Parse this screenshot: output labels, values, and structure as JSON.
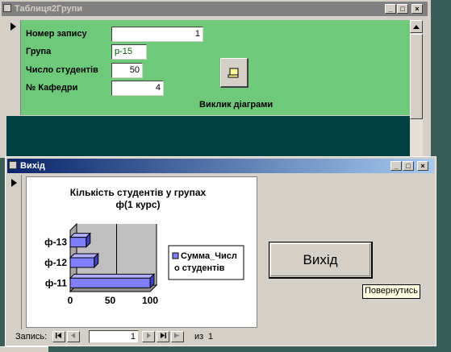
{
  "top_window": {
    "title": "Таблиця2Групи",
    "fields": [
      {
        "label": "Номер запису",
        "value": "1"
      },
      {
        "label": "Група",
        "value": "р-15"
      },
      {
        "label": "Число студентів",
        "value": "50"
      },
      {
        "label": "№ Кафедри",
        "value": "4"
      }
    ],
    "chart_button_label": "Виклик діаграми"
  },
  "bottom_window": {
    "title": "Вихід",
    "exit_button": "Вихід",
    "tooltip": "Повернутись"
  },
  "record_nav": {
    "label": "Запись:",
    "current": "1",
    "of_label": "из",
    "total": "1"
  },
  "window_controls": {
    "minimize": "_",
    "maximize": "□",
    "close": "×"
  },
  "chart_data": {
    "type": "bar",
    "orientation": "horizontal",
    "title": "Кількість студентів у групах",
    "subtitle": "ф(1 курс)",
    "categories": [
      "ф-11",
      "ф-12",
      "ф-13"
    ],
    "series": [
      {
        "name": "Сумма_Число студентів",
        "values": [
          100,
          30,
          20
        ]
      }
    ],
    "legend_lines": [
      "Сумма_Числ",
      "о студентів"
    ],
    "x_ticks": [
      "0",
      "50",
      "100"
    ],
    "xlim": [
      0,
      100
    ],
    "bar_color": "#8080ff",
    "legend_position": "right"
  }
}
